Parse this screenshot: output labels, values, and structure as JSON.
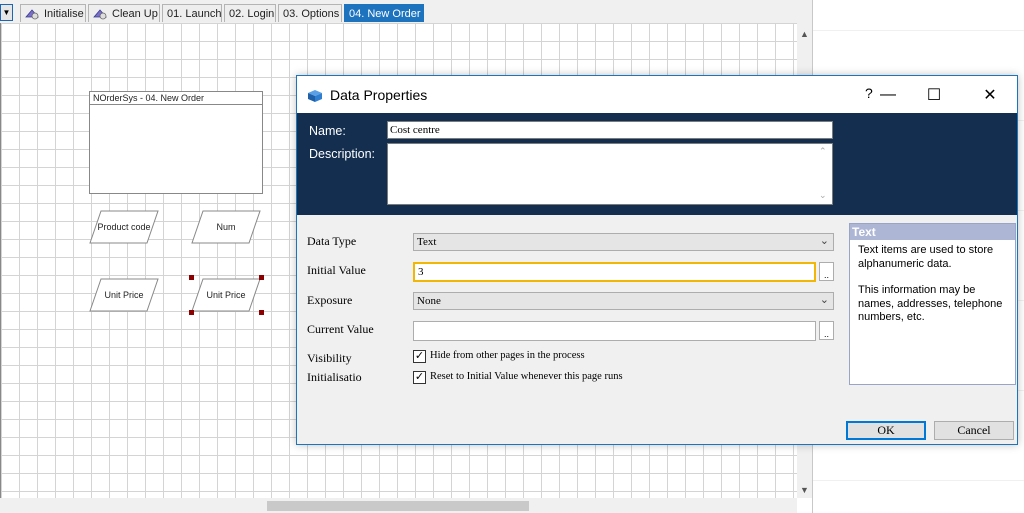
{
  "tabs": [
    {
      "label": "Initialise",
      "icon": "process-icon"
    },
    {
      "label": "Clean Up",
      "icon": "process-icon"
    },
    {
      "label": "01. Launch"
    },
    {
      "label": "02. Login"
    },
    {
      "label": "03. Options"
    },
    {
      "label": "04. New Order",
      "active": true
    }
  ],
  "canvas": {
    "page_box_title": "NOrderSys - 04. New Order",
    "shapes": [
      "Product code",
      "Num",
      "Unit Price",
      "Unit Price"
    ]
  },
  "dialog": {
    "title": "Data Properties",
    "help": "?",
    "name_label": "Name:",
    "name_value": "Cost centre",
    "description_label": "Description:",
    "description_value": "",
    "data_type_label": "Data Type",
    "data_type_value": "Text",
    "initial_value_label": "Initial Value",
    "initial_value": "3",
    "exposure_label": "Exposure",
    "exposure_value": "None",
    "current_value_label": "Current Value",
    "current_value": "",
    "visibility_label": "Visibility",
    "visibility_checkbox": "Hide from other pages in the process",
    "visibility_checked": true,
    "initialisation_label": "Initialisatio",
    "initialisation_checkbox": "Reset to Initial Value whenever this page runs",
    "initialisation_checked": true,
    "info_title": "Text",
    "info_line1": "Text items are used to store alphanumeric data.",
    "info_line2": "This information may be names, addresses, telephone numbers, etc.",
    "ok": "OK",
    "cancel": "Cancel",
    "ellipsis": ".."
  },
  "colors": {
    "header_bg": "#132e4f",
    "active_tab": "#1e73be",
    "focus_border": "#f2b705",
    "info_header": "#aeb6d6",
    "selection_handle": "#8b0000"
  }
}
